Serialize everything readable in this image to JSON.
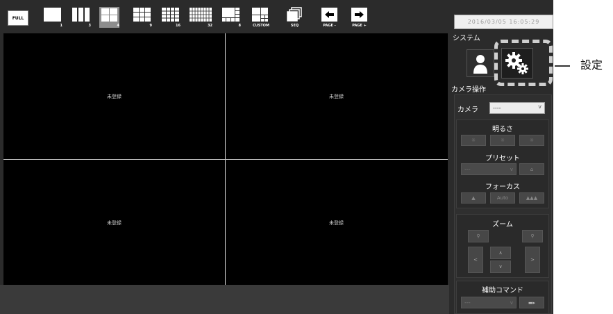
{
  "toolbar": {
    "full_label": "FULL",
    "layouts": [
      {
        "label": "1"
      },
      {
        "label": "3"
      },
      {
        "label": "4",
        "selected": true
      },
      {
        "label": "9"
      },
      {
        "label": "16"
      },
      {
        "label": "32"
      },
      {
        "label": "8"
      },
      {
        "label": "CUSTOM"
      }
    ],
    "seq_label": "SEQ",
    "page_prev_label": "PAGE -",
    "page_next_label": "PAGE +"
  },
  "viewer": {
    "cells": [
      {
        "status": "未登録"
      },
      {
        "status": "未登録"
      },
      {
        "status": "未登録"
      },
      {
        "status": "未登録"
      }
    ]
  },
  "clock": "2016/03/05 16:05:29",
  "system": {
    "title": "システム",
    "user_icon": "user-icon",
    "settings_icon": "gears-icon"
  },
  "callout": {
    "label": "設定"
  },
  "camera_ops": {
    "title": "カメラ操作",
    "camera_label": "カメラ",
    "camera_value": "----",
    "brightness": {
      "title": "明るさ"
    },
    "preset": {
      "title": "プリセット",
      "value": "---"
    },
    "focus": {
      "title": "フォーカス",
      "auto_label": "Auto"
    },
    "zoom": {
      "title": "ズーム"
    },
    "aux": {
      "title": "補助コマンド",
      "value": "---"
    }
  },
  "colors": {
    "background": "#2b2b2b",
    "viewer": "#000000",
    "highlight": "#cfcfcf"
  }
}
